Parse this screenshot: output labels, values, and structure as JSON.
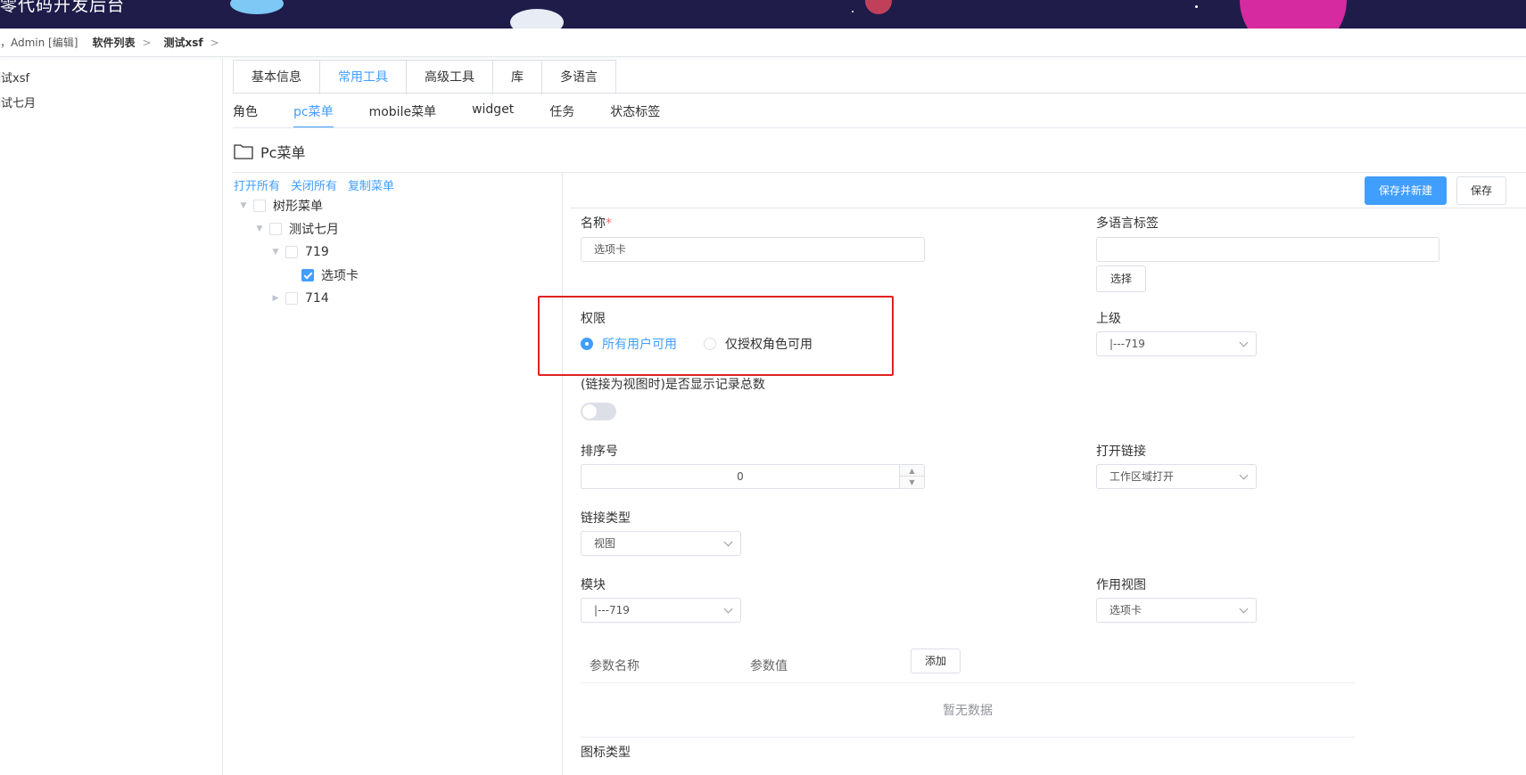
{
  "banner": {
    "title": "零代码开发后台"
  },
  "breadcrumb": {
    "user": "，Admin [编辑]",
    "items": [
      "软件列表",
      "测试xsf"
    ],
    "separator": ">"
  },
  "sidebar": {
    "items": [
      "测试xsf",
      "测试七月"
    ]
  },
  "tabs": [
    "基本信息",
    "常用工具",
    "高级工具",
    "库",
    "多语言"
  ],
  "subtabs": [
    "角色",
    "pc菜单",
    "mobile菜单",
    "widget",
    "任务",
    "状态标签"
  ],
  "section": {
    "title": "Pc菜单"
  },
  "tree": {
    "actions": [
      "打开所有",
      "关闭所有",
      "复制菜单"
    ],
    "nodes": [
      "树形菜单",
      "测试七月",
      "719",
      "选项卡",
      "714"
    ]
  },
  "actions": {
    "save_new": "保存并新建",
    "save": "保存"
  },
  "form": {
    "name_label": "名称",
    "name_required": "*",
    "name_value": "选项卡",
    "i18n_label": "多语言标签",
    "i18n_value": "",
    "choose_button": "选择",
    "permission_label": "权限",
    "permission_options": [
      "所有用户可用",
      "仅授权角色可用"
    ],
    "permission_selected": "所有用户可用",
    "parent_label": "上级",
    "parent_value": "|---719",
    "show_count_label": "(链接为视图时)是否显示记录总数",
    "show_count_on": false,
    "sort_label": "排序号",
    "sort_value": "0",
    "open_link_label": "打开链接",
    "open_link_value": "工作区域打开",
    "link_type_label": "链接类型",
    "link_type_value": "视图",
    "module_label": "模块",
    "module_value": "|---719",
    "view_label": "作用视图",
    "view_value": "选项卡",
    "param_name_col": "参数名称",
    "param_value_col": "参数值",
    "add_button": "添加",
    "empty_text": "暂无数据",
    "icon_type_label": "图标类型"
  },
  "colors": {
    "accent": "#409eff",
    "highlight": "#e02020",
    "banner": "#1f1c4a"
  }
}
